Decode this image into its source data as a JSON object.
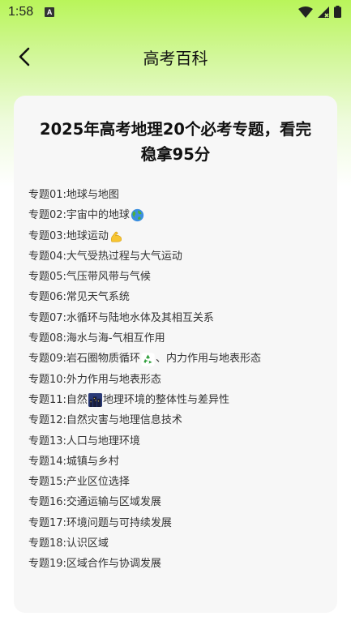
{
  "status": {
    "time": "1:58",
    "notification_letter": "A"
  },
  "header": {
    "title": "高考百科"
  },
  "article": {
    "title": "2025年高考地理20个必考专题，看完稳拿95分",
    "topics": [
      {
        "text": "专题01:地球与地图"
      },
      {
        "text": "专题02:宇宙中的地球",
        "emoji": "globe-icon"
      },
      {
        "text": "专题03:地球运动",
        "emoji": "flexed-arm-icon"
      },
      {
        "text": "专题04:大气受热过程与大气运动"
      },
      {
        "text": "专题05:气压带风带与气候"
      },
      {
        "text": "专题06:常见天气系统"
      },
      {
        "text": "专题07:水循环与陆地水体及其相互关系"
      },
      {
        "text": "专题08:海水与海-气相互作用"
      },
      {
        "text": "专题09:岩石圈物质循环",
        "emoji": "recycle-icon",
        "after": "、内力作用与地表形态"
      },
      {
        "text": "专题10:外力作用与地表形态"
      },
      {
        "text": "专题11:自然",
        "emoji": "city-night-icon",
        "after": "地理环境的整体性与差异性"
      },
      {
        "text": "专题12:自然灾害与地理信息技术"
      },
      {
        "text": "专题13:人口与地理环境"
      },
      {
        "text": "专题14:城镇与乡村"
      },
      {
        "text": "专题15:产业区位选择"
      },
      {
        "text": "专题16:交通运输与区域发展"
      },
      {
        "text": "专题17:环境问题与可持续发展"
      },
      {
        "text": "专题18:认识区域"
      },
      {
        "text": "专题19:区域合作与协调发展"
      }
    ]
  },
  "colors": {
    "header_gradient_top": "#b9f55a",
    "card_background": "#f7f7f7",
    "text_primary": "#111111",
    "text_list": "#333333"
  }
}
